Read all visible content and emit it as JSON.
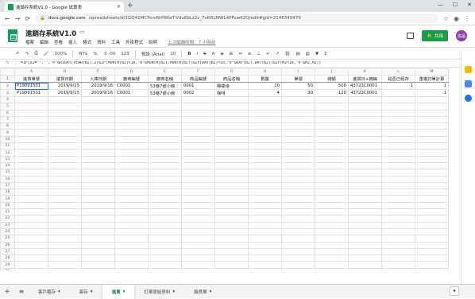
{
  "browser": {
    "tab_title": "進銷存系統V1.0 - Google 試算表",
    "url_host": "docs.google.com",
    "url_path": "/spreadsheets/d/1GQ41MCFemNrP6KeT-VduEbLz2z_7oKRLMWL4PFuw62Q/edit#gid=2146349479",
    "window_controls": [
      "—",
      "☐",
      "✕"
    ]
  },
  "app": {
    "doc_title": "進銷存系統V1.0",
    "menus": [
      "檔案",
      "編輯",
      "查看",
      "插入",
      "格式",
      "資料",
      "工具",
      "外掛程式",
      "說明"
    ],
    "last_edit": "上次編輯時間：7 小時前",
    "share_label": "共用",
    "avatar_initials": "信晶"
  },
  "toolbar": {
    "zoom": "100%",
    "currency": "NT$",
    "percent": "%",
    "decimals": ".0  .00",
    "format": "123",
    "font": "預設 (Arial)",
    "font_size": "10"
  },
  "formula_bar": {
    "label": "fx",
    "content": "=IF(D2=\"\",\"\",\"P\"&RIGHT(YEAR(B2),2)&IF(MONTH(B2)<10,\"0\"&MONTH(B2),MONTH(B2))&IF(DAY(B2)<10,\"0\"&DAY(B2),DAY(B2))&IF(M2<10,\"0\"&M2,M2))"
  },
  "grid": {
    "columns": [
      "A",
      "B",
      "C",
      "D",
      "E",
      "F",
      "G",
      "H",
      "I",
      "J",
      "K",
      "L",
      "M"
    ],
    "header_row": [
      "進貨單號",
      "進貨日期",
      "入庫日期",
      "廠商編號",
      "廠商名稱",
      "商品編號",
      "商品名稱",
      "數量",
      "單價",
      "總額",
      "進貨日+廠編",
      "是否已經存",
      "重複訂單計算"
    ],
    "rows": [
      [
        "P19091501",
        "2019/9/15",
        "2019/9/16",
        "C0001",
        "53巷7號小館",
        "0001",
        "檸檬塔",
        "10",
        "50",
        "500",
        "43723C0001",
        "1",
        "1"
      ],
      [
        "P19091501",
        "2019/9/15",
        "2019/9/16",
        "C0001",
        "53巷7號小館",
        "0002",
        "咖啡",
        "4",
        "30",
        "120",
        "43723C0001",
        "",
        "1"
      ]
    ],
    "row_numbers": [
      "1",
      "2",
      "3",
      "4",
      "5",
      "6",
      "7",
      "8",
      "9",
      "10",
      "11",
      "12",
      "13",
      "14",
      "15",
      "16",
      "17",
      "18",
      "19",
      "20",
      "21",
      "22",
      "23",
      "24",
      "25",
      "26",
      "27",
      "28",
      "29",
      "30"
    ]
  },
  "sheet_tabs": [
    {
      "label": "客戶範存",
      "active": false
    },
    {
      "label": "庫存",
      "active": false
    },
    {
      "label": "進貨",
      "active": true
    },
    {
      "label": "訂單原始資料",
      "active": false
    },
    {
      "label": "銷貨單",
      "active": false
    }
  ],
  "colors": {
    "accent": "#1a73e8",
    "brand": "#0f9d58",
    "share": "#1a9c4a",
    "active_tab": "#188038"
  }
}
